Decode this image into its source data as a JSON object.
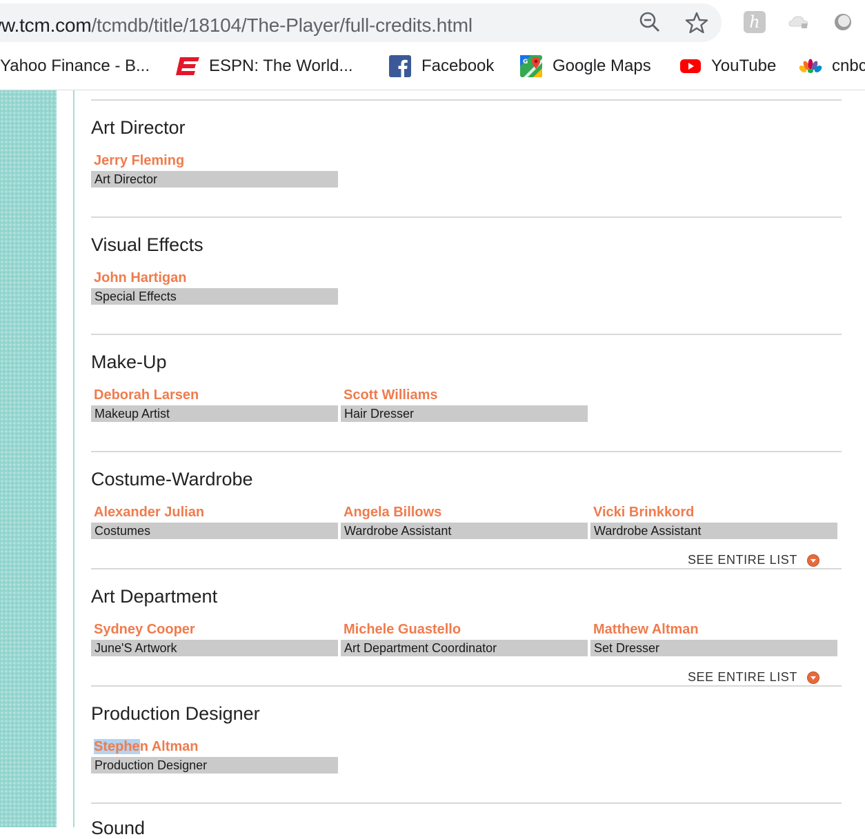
{
  "browser": {
    "url_host": "ww.tcm.com",
    "url_path": "/tcmdb/title/18104/The-Player/full-credits.html",
    "bookmarks": [
      {
        "label": "Yahoo Finance - B...",
        "icon": "none"
      },
      {
        "label": "ESPN: The World...",
        "icon": "espn-icon"
      },
      {
        "label": "Facebook",
        "icon": "facebook-icon"
      },
      {
        "label": "Google Maps",
        "icon": "google-maps-icon"
      },
      {
        "label": "YouTube",
        "icon": "youtube-icon"
      },
      {
        "label": "cnbc",
        "icon": "nbc-peacock-icon"
      }
    ]
  },
  "sections": [
    {
      "title": "Art Director",
      "credits": [
        {
          "name": "Jerry Fleming",
          "role": "Art Director"
        }
      ]
    },
    {
      "title": "Visual Effects",
      "credits": [
        {
          "name": "John Hartigan",
          "role": "Special Effects"
        }
      ]
    },
    {
      "title": "Make-Up",
      "credits": [
        {
          "name": "Deborah Larsen",
          "role": "Makeup Artist"
        },
        {
          "name": "Scott Williams",
          "role": "Hair Dresser"
        }
      ]
    },
    {
      "title": "Costume-Wardrobe",
      "credits": [
        {
          "name": "Alexander Julian",
          "role": "Costumes"
        },
        {
          "name": "Angela Billows",
          "role": "Wardrobe Assistant"
        },
        {
          "name": "Vicki Brinkkord",
          "role": "Wardrobe Assistant"
        }
      ],
      "see_all": "SEE ENTIRE LIST"
    },
    {
      "title": "Art Department",
      "credits": [
        {
          "name": "Sydney Cooper",
          "role": "June'S Artwork"
        },
        {
          "name": "Michele Guastello",
          "role": "Art Department Coordinator"
        },
        {
          "name": "Matthew Altman",
          "role": "Set Dresser"
        }
      ],
      "see_all": "SEE ENTIRE LIST"
    },
    {
      "title": "Production Designer",
      "credits": [
        {
          "name_highlighted": "Stephe",
          "name_rest": "n Altman",
          "role": "Production Designer"
        }
      ]
    }
  ],
  "next_section_title": "Sound",
  "colors": {
    "accent_name": "#f07b4d",
    "role_bg": "#cacaca",
    "teal": "#99d8d2",
    "selection": "#b5d3ee"
  }
}
